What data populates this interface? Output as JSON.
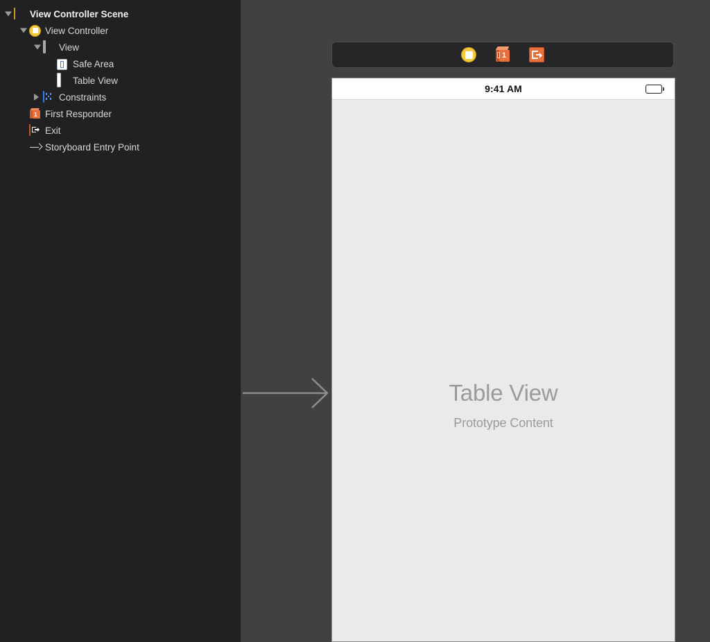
{
  "outline": {
    "items": [
      {
        "label": "View Controller Scene",
        "icon": "scene-icon",
        "indent": 0,
        "disclosure": "open",
        "bold": true
      },
      {
        "label": "View Controller",
        "icon": "view-controller-icon",
        "indent": 1,
        "disclosure": "open",
        "bold": false
      },
      {
        "label": "View",
        "icon": "view-icon",
        "indent": 2,
        "disclosure": "open",
        "bold": false
      },
      {
        "label": "Safe Area",
        "icon": "safe-area-icon",
        "indent": 3,
        "disclosure": "none",
        "bold": false
      },
      {
        "label": "Table View",
        "icon": "table-view-icon",
        "indent": 3,
        "disclosure": "none",
        "bold": false
      },
      {
        "label": "Constraints",
        "icon": "constraints-icon",
        "indent": 2,
        "disclosure": "closed",
        "bold": false
      },
      {
        "label": "First Responder",
        "icon": "first-responder-icon",
        "indent": 1,
        "disclosure": "none",
        "bold": false
      },
      {
        "label": "Exit",
        "icon": "exit-icon",
        "indent": 1,
        "disclosure": "none",
        "bold": false
      },
      {
        "label": "Storyboard Entry Point",
        "icon": "entry-point-arrow-icon",
        "indent": 1,
        "disclosure": "none",
        "bold": false
      }
    ]
  },
  "canvas": {
    "scene_dock": {
      "items": [
        {
          "name": "view-controller-dock-icon",
          "label": "View Controller"
        },
        {
          "name": "first-responder-dock-icon",
          "label": "First Responder",
          "badge": "1"
        },
        {
          "name": "exit-dock-icon",
          "label": "Exit"
        }
      ]
    },
    "entry_point_arrow_label": "Storyboard Entry Point",
    "device": {
      "status_bar": {
        "time": "9:41 AM",
        "battery": "full"
      },
      "table_view": {
        "title": "Table View",
        "subtitle": "Prototype Content"
      }
    }
  },
  "colors": {
    "sidebar_bg": "#212123",
    "canvas_bg": "#414141",
    "dock_bg": "#262628",
    "accent_yellow": "#f5c93c",
    "accent_orange": "#e8703d",
    "accent_blue": "#2f7ff0",
    "placeholder_gray": "#9a9a9a",
    "table_bg": "#eaeaea"
  }
}
